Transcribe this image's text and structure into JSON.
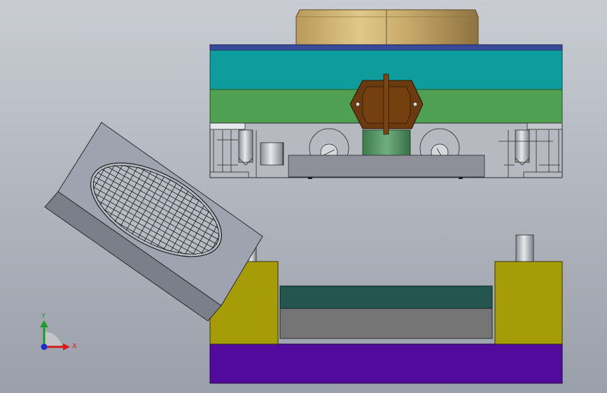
{
  "viewport": {
    "background_top": "#c9ccd3",
    "background_bottom": "#9aa0aa"
  },
  "colors": {
    "upper_cap": "#c8a867",
    "upper_top_plate": "#3a4a9a",
    "upper_cyan_plate": "#0e9c9c",
    "upper_green_plate": "#4fa052",
    "upper_base_body": "#b6b9c0",
    "upper_punch_plate": "#8d9099",
    "ring_part": "#6b3a0f",
    "lower_purple_base": "#520a9c",
    "lower_yellow_blocks": "#a59c07",
    "lower_dark_slab": "#24554f",
    "lower_grey_slab": "#757575",
    "tilted_part_top": "#9fa3af",
    "tilted_part_side": "#7b7f8a"
  },
  "triad": {
    "x_label": "X",
    "y_label": "Y",
    "x_color": "#d51a1a",
    "y_color": "#1f9a2b",
    "z_color": "#1e2fd1"
  }
}
